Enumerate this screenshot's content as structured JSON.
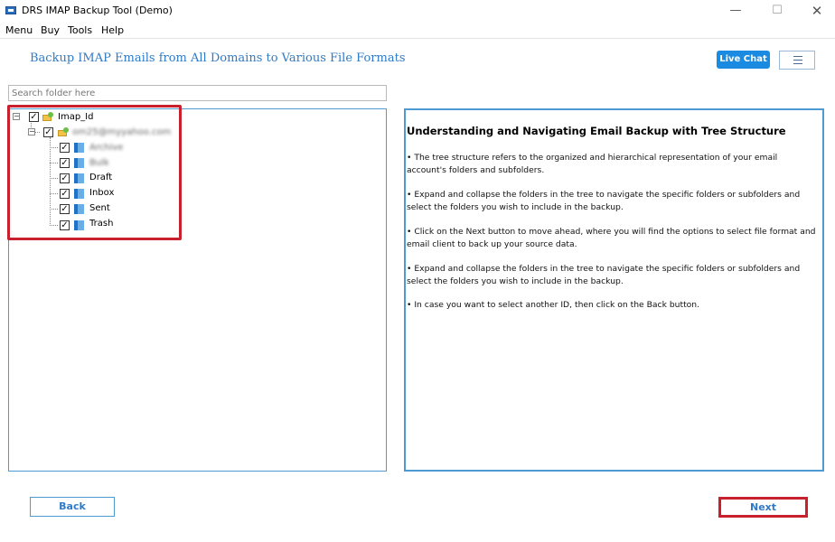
{
  "window": {
    "title": "DRS IMAP Backup Tool (Demo)",
    "controls": {
      "minimize": "—",
      "maximize": "☐",
      "close": "✕"
    }
  },
  "menu": {
    "items": [
      "Menu",
      "Buy",
      "Tools",
      "Help"
    ]
  },
  "header": {
    "heading": "Backup IMAP Emails from All Domains to Various File Formats",
    "live_chat_label": "Live Chat"
  },
  "search": {
    "placeholder": "Search folder here",
    "value": ""
  },
  "tree": {
    "root": {
      "label": "Imap_Id",
      "checked": true,
      "expanded": true
    },
    "account": {
      "label": "om25@myyahoo.com",
      "checked": true,
      "expanded": true
    },
    "folders": [
      {
        "label": "Archive",
        "checked": true
      },
      {
        "label": "Bulk",
        "checked": true
      },
      {
        "label": "Draft",
        "checked": true
      },
      {
        "label": "Inbox",
        "checked": true
      },
      {
        "label": "Sent",
        "checked": true
      },
      {
        "label": "Trash",
        "checked": true
      }
    ]
  },
  "info": {
    "title": "Understanding and Navigating Email Backup with Tree Structure",
    "paragraphs": [
      "• The tree structure refers to the organized and hierarchical representation of your email account's folders and subfolders.",
      "• Expand and collapse the folders in the tree to navigate the specific folders or subfolders and select the folders you wish to include in the backup.",
      "• Click on the Next button to move ahead, where you will find the options to select file format and email client to back up your source data.",
      "• Expand and collapse the folders in the tree to navigate the specific folders or subfolders and select the folders you wish to include in the backup.",
      "• In case you want to select another ID, then click on the Back button."
    ]
  },
  "footer": {
    "back_label": "Back",
    "next_label": "Next"
  },
  "colors": {
    "accent": "#2f7ac6",
    "live_chat_bg": "#1a8be0",
    "panel_border": "#4e9bd3",
    "highlight_red": "#c8202c"
  },
  "icons": {
    "app": "app-icon",
    "account": "email-account-icon",
    "folder": "folder-icon",
    "menu": "hamburger-icon"
  }
}
